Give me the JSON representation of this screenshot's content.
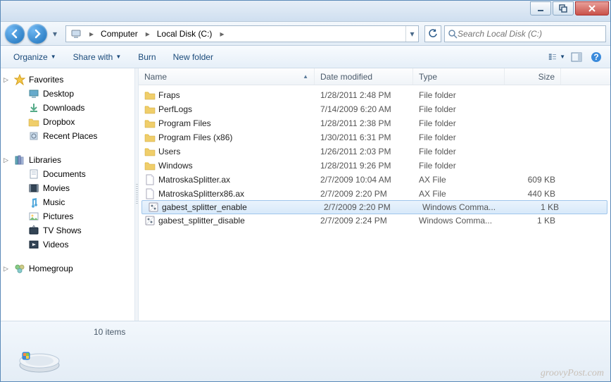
{
  "breadcrumb": {
    "seg0": "Computer",
    "seg1": "Local Disk (C:)"
  },
  "search": {
    "placeholder": "Search Local Disk (C:)"
  },
  "toolbar": {
    "organize": "Organize",
    "share": "Share with",
    "burn": "Burn",
    "newfolder": "New folder"
  },
  "sidebar": {
    "favorites": {
      "label": "Favorites",
      "items": [
        "Desktop",
        "Downloads",
        "Dropbox",
        "Recent Places"
      ]
    },
    "libraries": {
      "label": "Libraries",
      "items": [
        "Documents",
        "Movies",
        "Music",
        "Pictures",
        "TV Shows",
        "Videos"
      ]
    },
    "homegroup": {
      "label": "Homegroup"
    }
  },
  "columns": {
    "name": "Name",
    "date": "Date modified",
    "type": "Type",
    "size": "Size"
  },
  "files": [
    {
      "name": "Fraps",
      "date": "1/28/2011 2:48 PM",
      "type": "File folder",
      "size": "",
      "icon": "folder"
    },
    {
      "name": "PerfLogs",
      "date": "7/14/2009 6:20 AM",
      "type": "File folder",
      "size": "",
      "icon": "folder"
    },
    {
      "name": "Program Files",
      "date": "1/28/2011 2:38 PM",
      "type": "File folder",
      "size": "",
      "icon": "folder"
    },
    {
      "name": "Program Files (x86)",
      "date": "1/30/2011 6:31 PM",
      "type": "File folder",
      "size": "",
      "icon": "folder"
    },
    {
      "name": "Users",
      "date": "1/26/2011 2:03 PM",
      "type": "File folder",
      "size": "",
      "icon": "folder"
    },
    {
      "name": "Windows",
      "date": "1/28/2011 9:26 PM",
      "type": "File folder",
      "size": "",
      "icon": "folder"
    },
    {
      "name": "MatroskaSplitter.ax",
      "date": "2/7/2009 10:04 AM",
      "type": "AX File",
      "size": "609 KB",
      "icon": "file"
    },
    {
      "name": "MatroskaSplitterx86.ax",
      "date": "2/7/2009 2:20 PM",
      "type": "AX File",
      "size": "440 KB",
      "icon": "file"
    },
    {
      "name": "gabest_splitter_enable",
      "date": "2/7/2009 2:20 PM",
      "type": "Windows Comma...",
      "size": "1 KB",
      "icon": "cmd",
      "selected": true
    },
    {
      "name": "gabest_splitter_disable",
      "date": "2/7/2009 2:24 PM",
      "type": "Windows Comma...",
      "size": "1 KB",
      "icon": "cmd"
    }
  ],
  "status": {
    "count": "10 items"
  },
  "watermark": "groovyPost.com"
}
